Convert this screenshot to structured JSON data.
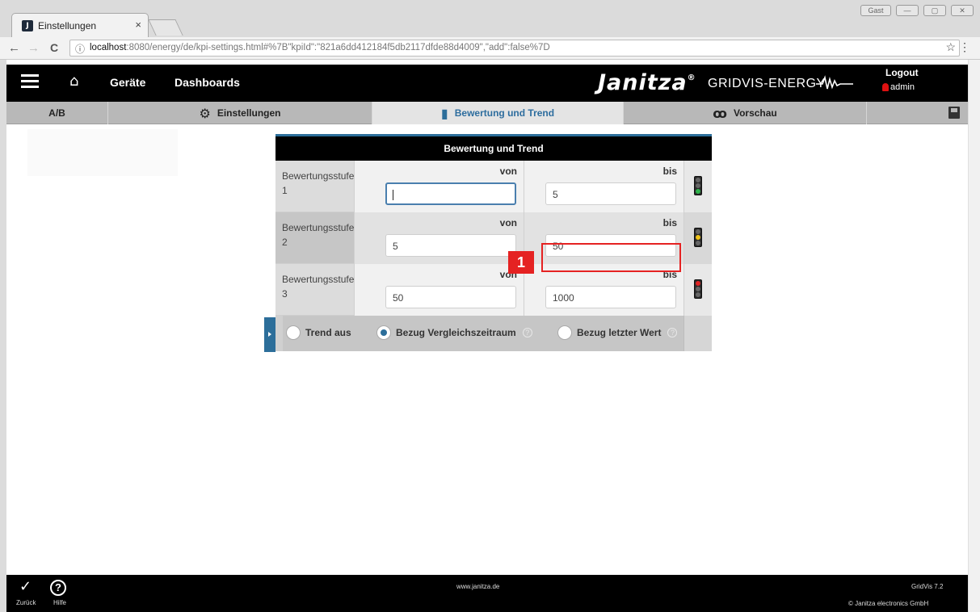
{
  "browser": {
    "tab_title": "Einstellungen",
    "tab_close": "×",
    "url_info_icon": "ⓘ",
    "url_host": "localhost",
    "url_rest": ":8080/energy/de/kpi-settings.html#%7B\"kpiId\":\"821a6dd412184f5db2117dfde88d4009\",\"add\":false%7D",
    "window_button_user": "Gast",
    "nav_back": "←",
    "nav_forward": "→",
    "reload": "C",
    "star": "☆",
    "menu": "⋮"
  },
  "header": {
    "nav_devices": "Geräte",
    "nav_dashboards": "Dashboards",
    "brand": "Janitza",
    "brand_reg": "®",
    "brand_sub": "GRIDVIS-ENERGY",
    "logout": "Logout",
    "username": "admin"
  },
  "tabs": {
    "ab": "A/B",
    "settings": "Einstellungen",
    "rating": "Bewertung und Trend",
    "preview": "Vorschau"
  },
  "panel": {
    "title": "Bewertung und Trend",
    "von_label": "von",
    "bis_label": "bis",
    "rows": [
      {
        "label_line1": "Bewertungsstufe",
        "label_line2": "1",
        "von": "",
        "bis": "5",
        "light": "green"
      },
      {
        "label_line1": "Bewertungsstufe",
        "label_line2": "2",
        "von": "5",
        "bis": "50",
        "light": "yellow"
      },
      {
        "label_line1": "Bewertungsstufe",
        "label_line2": "3",
        "von": "50",
        "bis": "1000",
        "light": "red"
      }
    ],
    "trend": {
      "off": "Trend aus",
      "comparison": "Bezug Vergleichszeitraum",
      "last_value": "Bezug letzter Wert",
      "selected": "comparison"
    }
  },
  "annotation": {
    "step": "1"
  },
  "footer": {
    "back": "Zurück",
    "help": "Hilfe",
    "help_glyph": "?",
    "website": "www.janitza.de",
    "version": "GridVis 7.2",
    "copyright": "© Janitza electronics GmbH"
  },
  "colors": {
    "accent": "#2c6e9a",
    "annotation": "#e52222"
  }
}
